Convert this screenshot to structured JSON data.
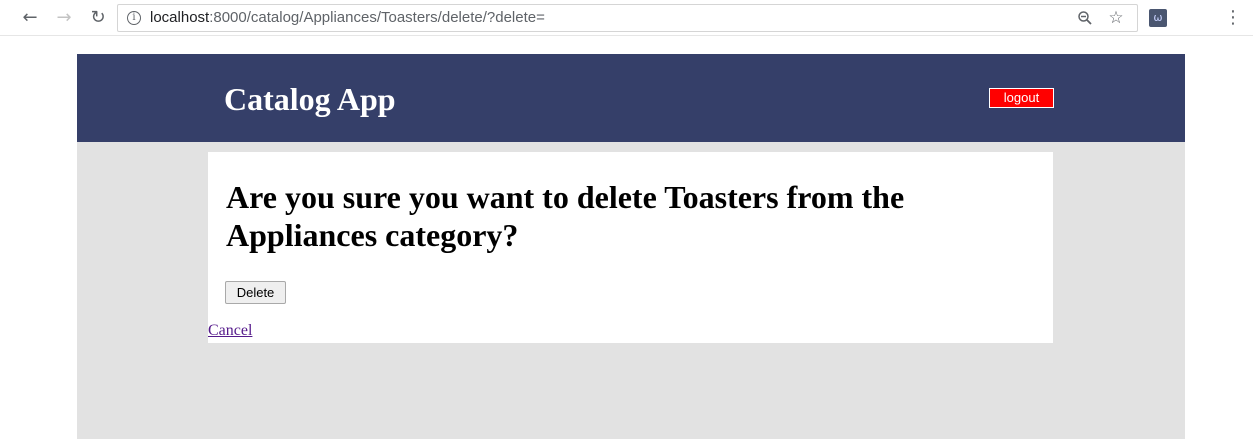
{
  "browser": {
    "url_host": "localhost",
    "url_rest": ":8000/catalog/Appliances/Toasters/delete/?delete=",
    "icons": {
      "back": "arrow-left-icon",
      "forward": "arrow-right-icon",
      "reload": "reload-icon",
      "info": "info-icon",
      "zoom": "zoom-out-icon",
      "bookmark": "star-icon",
      "extension": "extension-icon",
      "menu": "kebab-menu-icon"
    }
  },
  "header": {
    "title": "Catalog App",
    "logout_label": "logout",
    "background_color": "#353f69",
    "logout_color": "#ff0000"
  },
  "main": {
    "heading": "Are you sure you want to delete Toasters from the Appliances category?",
    "delete_label": "Delete",
    "cancel_label": "Cancel"
  },
  "colors": {
    "page_background": "#e2e2e2",
    "card_background": "#ffffff",
    "visited_link": "#551a8b"
  }
}
